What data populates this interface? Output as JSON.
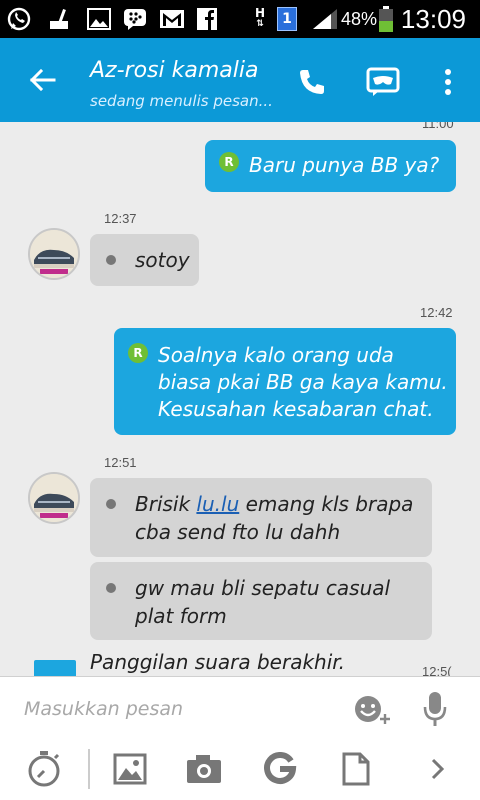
{
  "status_bar": {
    "network_type": "H",
    "sim_slot": "1",
    "battery_percent": "48%",
    "battery_level": 0.48,
    "time": "13:09",
    "icons": [
      "whatsapp-icon",
      "broom-icon",
      "gallery-icon",
      "bbm-icon",
      "gmail-icon",
      "facebook-icon",
      "signal-icon",
      "battery-icon"
    ]
  },
  "header": {
    "contact_name": "Az-rosi kamalia",
    "status": "sedang menulis pesan...",
    "background_color": "#0c99d7"
  },
  "messages": {
    "top_cut_time": "11:00",
    "m1": {
      "direction": "out",
      "badge": "R",
      "text": "Baru punya BB ya?"
    },
    "t2": "12:37",
    "m2": {
      "direction": "in",
      "text": "sotoy"
    },
    "t3": "12:42",
    "m3": {
      "direction": "out",
      "badge": "R",
      "lines": [
        "Soalnya kalo orang uda",
        "biasa pkai BB ga kaya kamu.",
        "Kesusahan kesabaran chat."
      ]
    },
    "t4": "12:51",
    "m4": {
      "direction": "in",
      "line1_before": "Brisik ",
      "line1_link": "lu.lu",
      "line1_after": " emang kls brapa",
      "line2": "cba send fto lu dahh"
    },
    "m5": {
      "direction": "in",
      "lines": [
        "gw mau bli sepatu casual",
        "plat form"
      ]
    },
    "system": "Panggilan suara berakhir.",
    "system_time_cut": "12:5("
  },
  "composer": {
    "placeholder": "Masukkan pesan",
    "value": ""
  },
  "actions": [
    "timer-icon",
    "gallery-icon",
    "camera-icon",
    "google-icon",
    "file-icon",
    "chevron-right-icon"
  ],
  "colors": {
    "outgoing_bubble": "#1ca6df",
    "incoming_bubble": "#d4d4d4",
    "read_badge": "#6fbf35"
  }
}
